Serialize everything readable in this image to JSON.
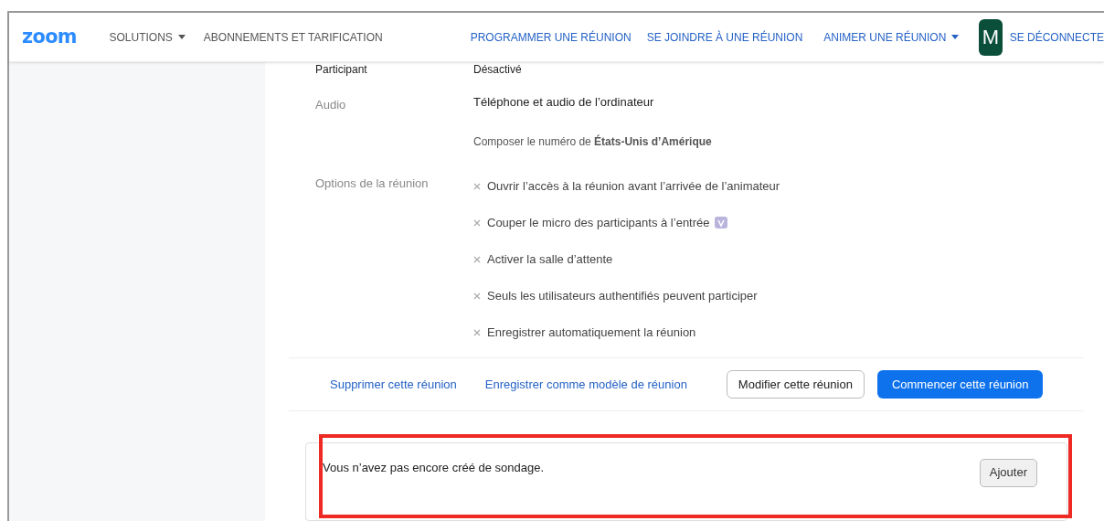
{
  "header": {
    "logo": "zoom",
    "nav_left": [
      {
        "label": "SOLUTIONS",
        "dropdown": true
      },
      {
        "label": "ABONNEMENTS ET TARIFICATION",
        "dropdown": false
      }
    ],
    "nav_right": [
      {
        "label": "PROGRAMMER UNE RÉUNION",
        "dropdown": false
      },
      {
        "label": "SE JOINDRE À UNE RÉUNION",
        "dropdown": false
      },
      {
        "label": "ANIMER UNE RÉUNION",
        "dropdown": true
      }
    ],
    "avatar": "M",
    "signout": "SE DÉCONNECTE"
  },
  "partial_row": {
    "label": "Participant",
    "value": "Désactivé"
  },
  "audio": {
    "label": "Audio",
    "value": "Téléphone et audio de l’ordinateur",
    "dial": "Composer le numéro de **États-Unis d’Amérique**"
  },
  "options": {
    "label": "Options de la réunion",
    "items": [
      {
        "text": "Ouvrir l’accès à la réunion avant l’arrivée de l’animateur",
        "enabled": false,
        "badge": false
      },
      {
        "text": "Couper le micro des participants à l’entrée",
        "enabled": false,
        "badge": true
      },
      {
        "text": "Activer la salle d’attente",
        "enabled": false,
        "badge": false
      },
      {
        "text": "Seuls les utilisateurs authentifiés peuvent participer",
        "enabled": false,
        "badge": false
      },
      {
        "text": "Enregistrer automatiquement la réunion",
        "enabled": false,
        "badge": false
      }
    ]
  },
  "actions": {
    "links": [
      "Supprimer cette réunion",
      "Enregistrer comme modèle de réunion"
    ],
    "edit": "Modifier cette réunion",
    "start": "Commencer cette réunion"
  },
  "poll": {
    "message": "Vous n’avez pas encore créé de sondage.",
    "button": "Ajouter"
  }
}
